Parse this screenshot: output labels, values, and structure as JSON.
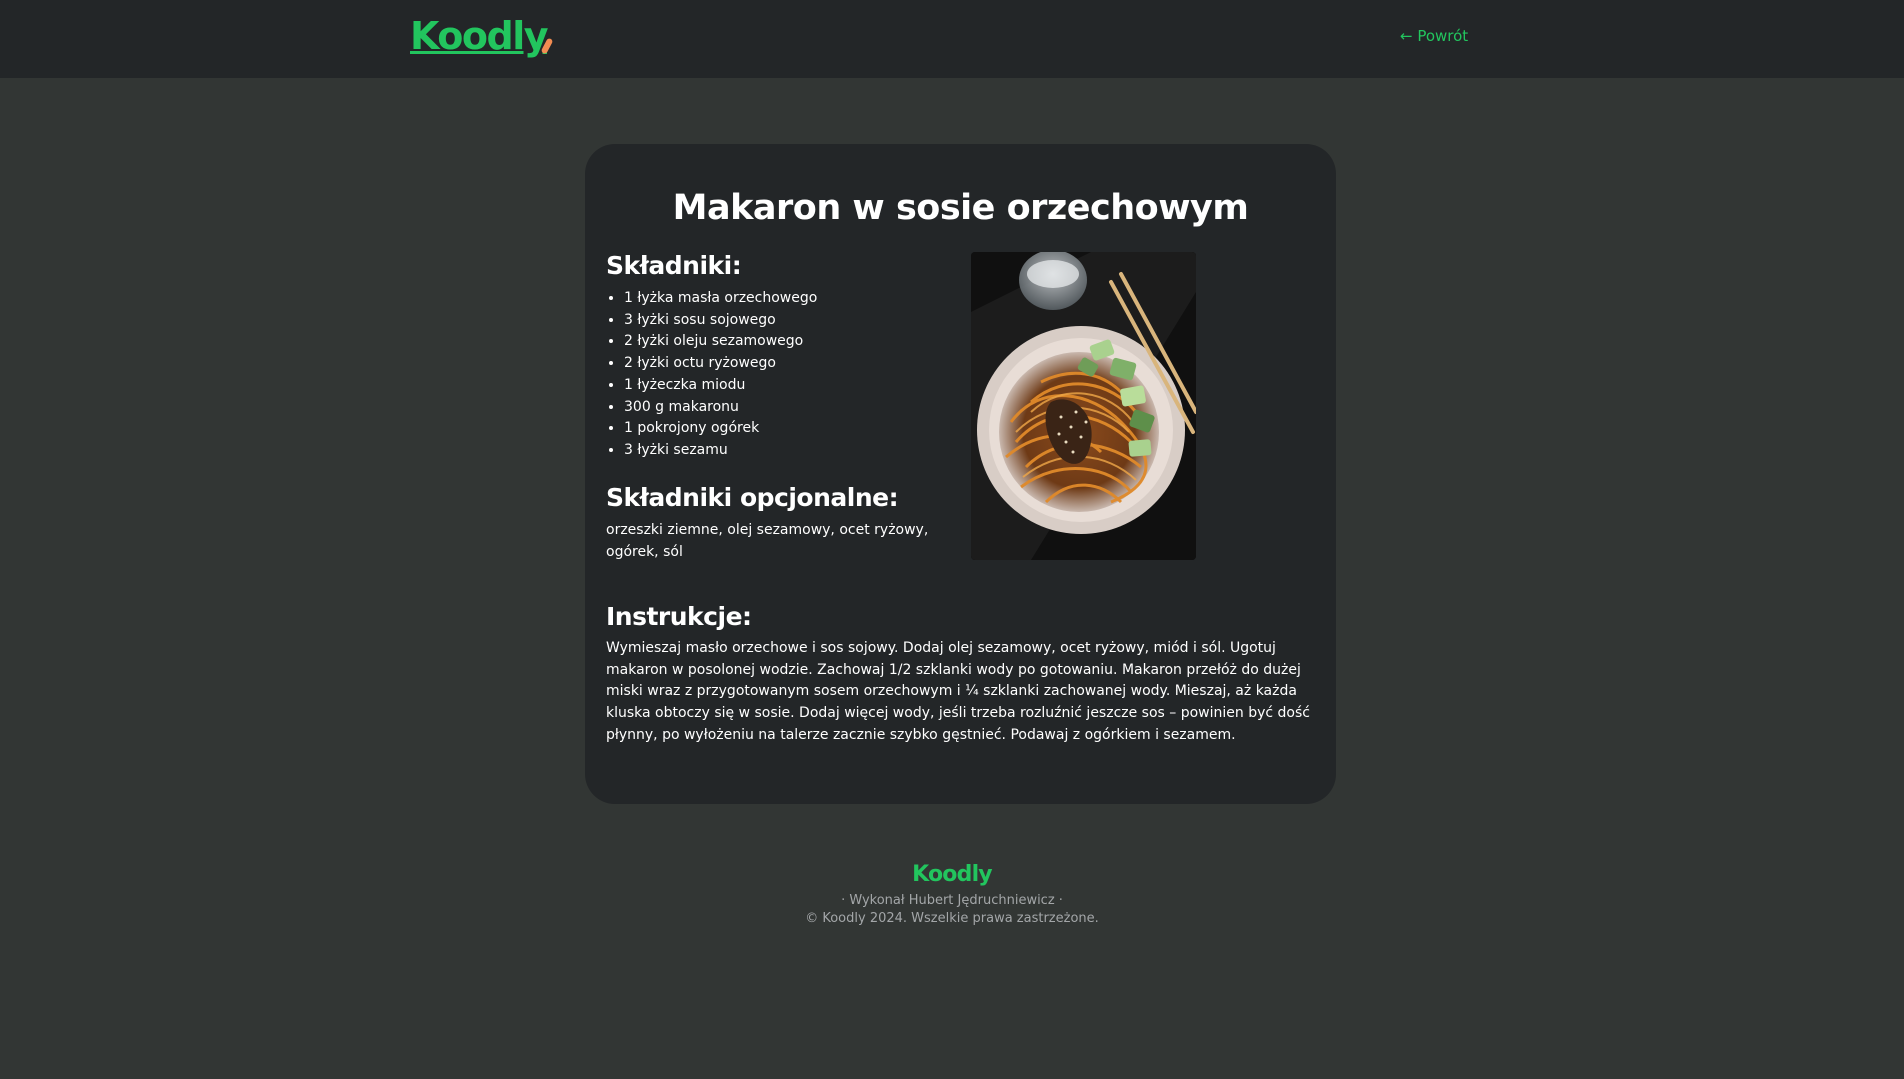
{
  "header": {
    "logo": "Koodly",
    "back_link": "← Powrót"
  },
  "recipe": {
    "title": "Makaron w sosie orzechowym",
    "ingredients_heading": "Składniki:",
    "ingredients": [
      "1 łyżka masła orzechowego",
      "3 łyżki sosu sojowego",
      "2 łyżki oleju sezamowego",
      "2 łyżki octu ryżowego",
      "1 łyżeczka miodu",
      "300 g makaronu",
      "1 pokrojony ogórek",
      "3 łyżki sezamu"
    ],
    "optional_heading": "Składniki opcjonalne:",
    "optional_text": "orzeszki ziemne, olej sezamowy, ocet ryżowy, ogórek, sól",
    "instructions_heading": "Instrukcje:",
    "instructions_text": "Wymieszaj masło orzechowe i sos sojowy. Dodaj olej sezamowy, ocet ryżowy, miód i sól. Ugotuj makaron w posolonej wodzie. Zachowaj 1/2 szklanki wody po gotowaniu. Makaron przełóż do dużej miski wraz z przygotowanym sosem orzechowym i ¼ szklanki zachowanej wody. Mieszaj, aż każda kluska obtoczy się w sosie. Dodaj więcej wody, jeśli trzeba rozluźnić jeszcze sos – powinien być dość płynny, po wyłożeniu na talerze zacznie szybko gęstnieć. Podawaj z ogórkiem i sezamem."
  },
  "footer": {
    "logo": "Koodly",
    "credits": "·  Wykonał Hubert Jędruchniewicz  ·",
    "copyright": "© Koodly 2024. Wszelkie prawa zastrzeżone."
  },
  "colors": {
    "accent": "#22c55e",
    "page_bg": "#323634",
    "card_bg": "#232628",
    "logo_mark": "#f28c52"
  }
}
